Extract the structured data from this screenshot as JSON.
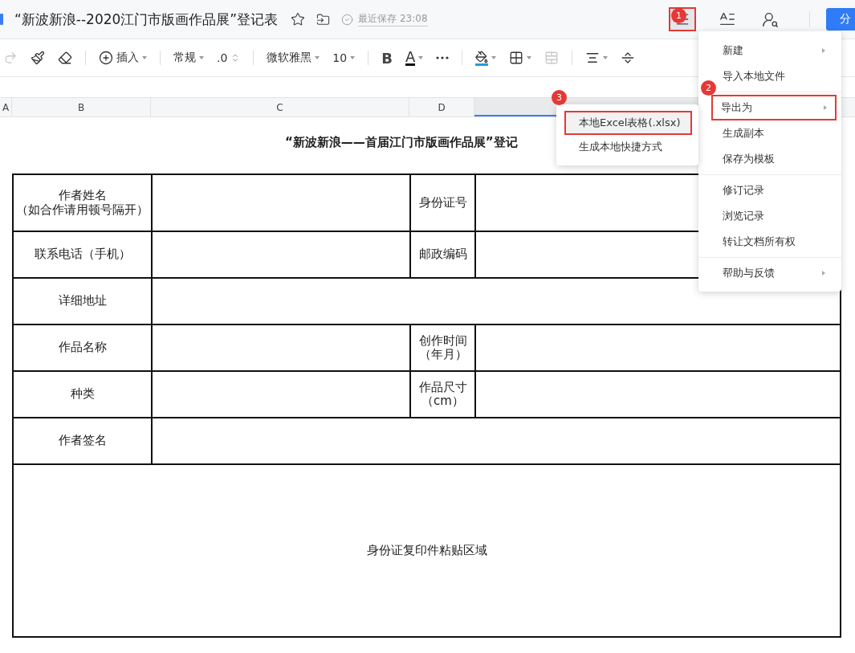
{
  "document": {
    "title": "“新波新浪--2020江门市版画作品展”登记表",
    "save_status": "最近保存 23:08"
  },
  "header": {
    "menu_button": {
      "highlighted": true,
      "badge": "1"
    },
    "share_label": "分"
  },
  "toolbar": [
    {
      "kind": "redo",
      "disabled": true
    },
    {
      "kind": "painter"
    },
    {
      "kind": "eraser"
    },
    {
      "kind": "divider"
    },
    {
      "kind": "insert",
      "label": "插入"
    },
    {
      "kind": "divider"
    },
    {
      "kind": "dropdown",
      "label": "常规"
    },
    {
      "kind": "stepper",
      "label": ".0"
    },
    {
      "kind": "divider"
    },
    {
      "kind": "dropdown",
      "label": "微软雅黑"
    },
    {
      "kind": "dropdown",
      "label": "10"
    },
    {
      "kind": "divider"
    },
    {
      "kind": "bold",
      "label": "B"
    },
    {
      "kind": "font-color",
      "label": "A"
    },
    {
      "kind": "more"
    },
    {
      "kind": "divider"
    },
    {
      "kind": "fill"
    },
    {
      "kind": "border"
    },
    {
      "kind": "merge",
      "disabled": true
    },
    {
      "kind": "divider"
    },
    {
      "kind": "align"
    },
    {
      "kind": "valign"
    }
  ],
  "columns": [
    {
      "label": "A",
      "selected": false
    },
    {
      "label": "B",
      "selected": false
    },
    {
      "label": "C",
      "selected": false
    },
    {
      "label": "D",
      "selected": false
    },
    {
      "selected": true
    }
  ],
  "sheet": {
    "title": "“新波新浪——首届江门市版画作品展”登记",
    "rows": [
      {
        "kind": "pair",
        "label": "作者姓名",
        "note": "（如合作请用顿号隔开）",
        "label_2": "身份证号"
      },
      {
        "kind": "pair",
        "label": "联系电话（手机）",
        "label_2": "邮政编码"
      },
      {
        "kind": "wide",
        "label": "详细地址"
      },
      {
        "kind": "pair",
        "label": "作品名称",
        "label_2": "创作时间",
        "note_2": "（年月）"
      },
      {
        "kind": "pair",
        "label": "种类",
        "label_2": "作品尺寸",
        "note_2": "（cm）"
      },
      {
        "kind": "wide",
        "label": "作者签名"
      },
      {
        "kind": "full",
        "label": "身份证复印件粘贴区域"
      }
    ]
  },
  "menu": {
    "badge": "2",
    "items": [
      {
        "kind": "item",
        "label": "新建",
        "submenu": true,
        "highlighted": false
      },
      {
        "kind": "item",
        "label": "导入本地文件",
        "submenu": false,
        "highlighted": false
      },
      {
        "kind": "divider"
      },
      {
        "kind": "item",
        "label": "导出为",
        "submenu": true,
        "highlighted": true
      },
      {
        "kind": "item",
        "label": "生成副本",
        "submenu": false,
        "highlighted": false
      },
      {
        "kind": "item",
        "label": "保存为模板",
        "submenu": false,
        "highlighted": false
      },
      {
        "kind": "divider"
      },
      {
        "kind": "item",
        "label": "修订记录",
        "submenu": false,
        "highlighted": false
      },
      {
        "kind": "item",
        "label": "浏览记录",
        "submenu": false,
        "highlighted": false
      },
      {
        "kind": "item",
        "label": "转让文档所有权",
        "submenu": false,
        "highlighted": false
      },
      {
        "kind": "divider"
      },
      {
        "kind": "item",
        "label": "帮助与反馈",
        "submenu": true,
        "highlighted": false
      }
    ]
  },
  "submenu": {
    "badge": "3",
    "items": [
      {
        "label": "本地Excel表格(.xlsx)",
        "selected": true
      },
      {
        "label": "生成本地快捷方式",
        "selected": false
      }
    ]
  }
}
